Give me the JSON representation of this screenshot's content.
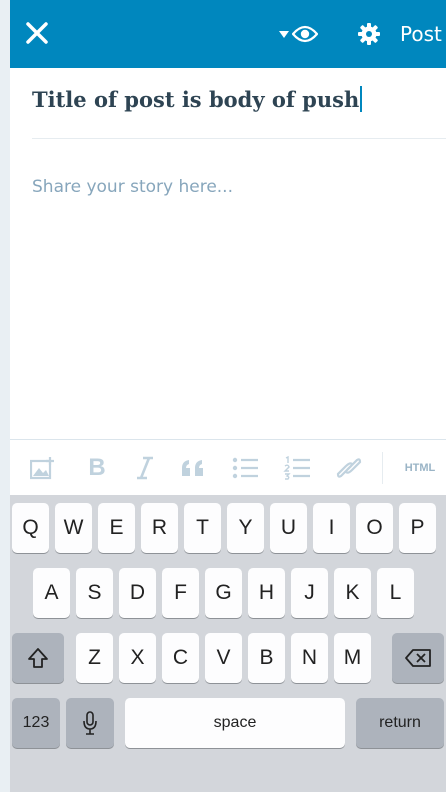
{
  "toolbar": {
    "post_label": "Post",
    "close_icon": "close-icon",
    "preview_icon": "eye-icon",
    "settings_icon": "gear-icon",
    "background_color": "#0087be"
  },
  "editor": {
    "title": "Title of post is body of push",
    "body_placeholder": "Share your story here..."
  },
  "format_toolbar": {
    "items": [
      "image-icon",
      "bold-icon",
      "italic-icon",
      "quote-icon",
      "bullet-list-icon",
      "numbered-list-icon",
      "link-icon"
    ],
    "bold_label": "B",
    "html_label": "HTML",
    "icon_color": "#c0d2de"
  },
  "keyboard": {
    "row1": [
      "Q",
      "W",
      "E",
      "R",
      "T",
      "Y",
      "U",
      "I",
      "O",
      "P"
    ],
    "row2": [
      "A",
      "S",
      "D",
      "F",
      "G",
      "H",
      "J",
      "K",
      "L"
    ],
    "row3": [
      "Z",
      "X",
      "C",
      "V",
      "B",
      "N",
      "M"
    ],
    "numbers_label": "123",
    "space_label": "space",
    "return_label": "return",
    "shift_icon": "shift-icon",
    "delete_icon": "backspace-icon",
    "mic_icon": "microphone-icon"
  }
}
